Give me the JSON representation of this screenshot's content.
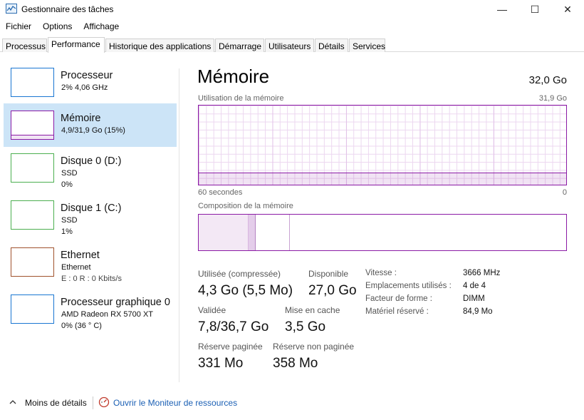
{
  "window": {
    "title": "Gestionnaire des tâches",
    "minimize": "—",
    "maximize": "☐",
    "close": "✕"
  },
  "menu": [
    "Fichier",
    "Options",
    "Affichage"
  ],
  "tabs": [
    "Processus",
    "Performance",
    "Historique des applications",
    "Démarrage",
    "Utilisateurs",
    "Détails",
    "Services"
  ],
  "active_tab": "Performance",
  "sidebar": {
    "items": [
      {
        "name": "Processeur",
        "line1": "2% 4,06 GHz",
        "line2": "",
        "color": "#1976d2"
      },
      {
        "name": "Mémoire",
        "line1": "4,9/31,9 Go (15%)",
        "line2": "",
        "color": "#8b1aa5",
        "selected": true
      },
      {
        "name": "Disque 0 (D:)",
        "line1": "SSD",
        "line2": "0%",
        "color": "#4caf50"
      },
      {
        "name": "Disque 1 (C:)",
        "line1": "SSD",
        "line2": "1%",
        "color": "#4caf50"
      },
      {
        "name": "Ethernet",
        "line1": "Ethernet",
        "line2": "E : 0 R : 0 Kbits/s",
        "color": "#a0522d"
      },
      {
        "name": "Processeur graphique 0",
        "line1": "AMD Radeon RX 5700 XT",
        "line2": "0% (36 ° C)",
        "color": "#1976d2"
      }
    ]
  },
  "main": {
    "title": "Mémoire",
    "total": "32,0 Go",
    "usage_label": "Utilisation de la mémoire",
    "usage_max": "31,9 Go",
    "usage_fraction": 0.15,
    "time_left": "60 secondes",
    "time_right": "0",
    "composition_label": "Composition de la mémoire",
    "stats": {
      "used_label": "Utilisée (compressée)",
      "used_value": "4,3 Go (5,5 Mo)",
      "available_label": "Disponible",
      "available_value": "27,0 Go",
      "committed_label": "Validée",
      "committed_value": "7,8/36,7 Go",
      "cached_label": "Mise en cache",
      "cached_value": "3,5 Go",
      "paged_label": "Réserve paginée",
      "paged_value": "331 Mo",
      "nonpaged_label": "Réserve non paginée",
      "nonpaged_value": "358 Mo"
    },
    "details": [
      {
        "label": "Vitesse :",
        "value": "3666 MHz"
      },
      {
        "label": "Emplacements utilisés :",
        "value": "4 de 4"
      },
      {
        "label": "Facteur de forme :",
        "value": "DIMM"
      },
      {
        "label": "Matériel réservé :",
        "value": "84,9 Mo"
      }
    ],
    "accent_color": "#8b1aa5"
  },
  "footer": {
    "less_details": "Moins de détails",
    "resource_monitor": "Ouvrir le Moniteur de ressources"
  }
}
